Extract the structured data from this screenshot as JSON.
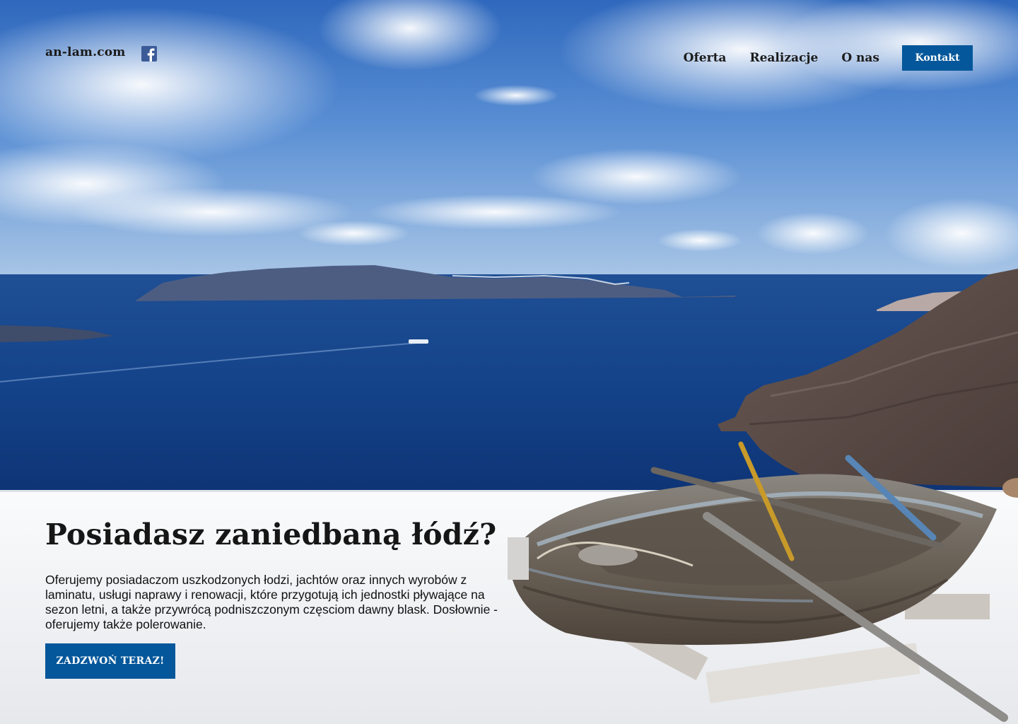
{
  "header": {
    "logo": "an-lam.com",
    "social_icon": "facebook-icon",
    "nav": [
      {
        "label": "Oferta"
      },
      {
        "label": "Realizacje"
      },
      {
        "label": "O nas"
      }
    ],
    "cta_label": "Kontakt"
  },
  "hero": {
    "title": "Posiadasz zaniedbaną łódź?",
    "text": "Oferujemy posiadaczom uszkodzonych łodzi, jachtów oraz innych wyrobów z laminatu, usługi naprawy i renowacji, które przygotują ich jednostki pływające na sezon letni, a także przywrócą podniszczonym częsciom dawny blask. Dosłownie - oferujemy także polerowanie.",
    "cta_label": "ZADZWOŃ TERAZ!"
  },
  "colors": {
    "accent": "#03579a",
    "sea": "#1f4f94",
    "sky": "#3d74c4"
  }
}
